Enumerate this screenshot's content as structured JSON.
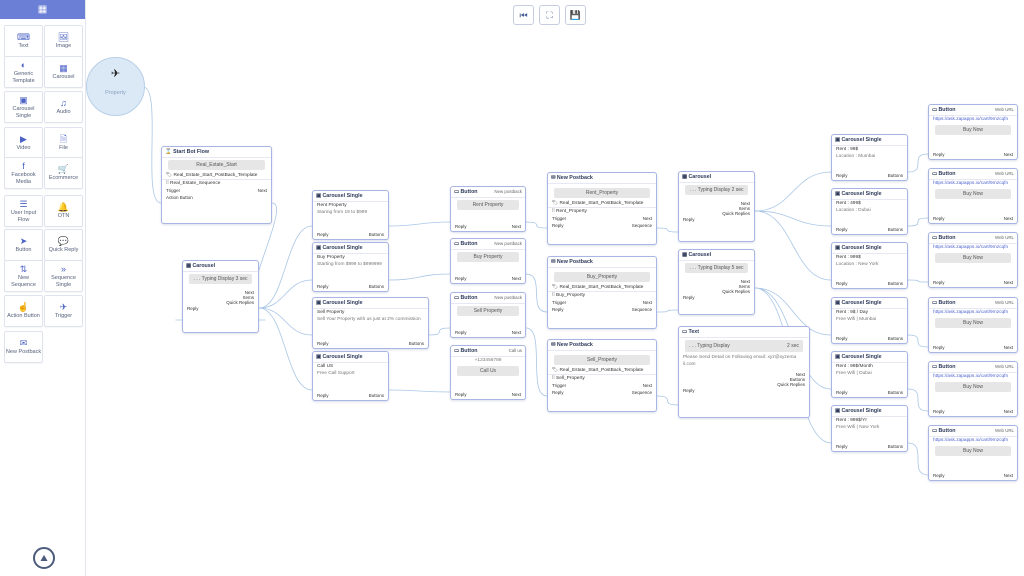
{
  "app": {
    "menu_icon": "grid-icon"
  },
  "toolbar": [
    {
      "name": "go-start-button",
      "icon": "⏮"
    },
    {
      "name": "fit-view-button",
      "icon": "⛶"
    },
    {
      "name": "save-button",
      "icon": "💾"
    }
  ],
  "sidebar": [
    {
      "label": "Text",
      "icon": "⌨"
    },
    {
      "label": "Image",
      "icon": "🖼"
    },
    {
      "label": "Generic Template",
      "icon": "◐"
    },
    {
      "label": "Carousel",
      "icon": "▦"
    },
    {
      "label": "Carousel Single",
      "icon": "▣"
    },
    {
      "label": "Audio",
      "icon": "♫"
    },
    {
      "label": "Video",
      "icon": "▶"
    },
    {
      "label": "File",
      "icon": "🗎"
    },
    {
      "label": "Facebook Media",
      "icon": "f"
    },
    {
      "label": "Ecommerce",
      "icon": "🛒"
    },
    {
      "label": "User Input Flow",
      "icon": "☰"
    },
    {
      "label": "OTN",
      "icon": "🔔"
    },
    {
      "label": "Button",
      "icon": "➤"
    },
    {
      "label": "Quick Reply",
      "icon": "💬"
    },
    {
      "label": "New Sequence",
      "icon": "⇅"
    },
    {
      "label": "Sequence Single",
      "icon": "»"
    },
    {
      "label": "Action Button",
      "icon": "☝"
    },
    {
      "label": "Trigger",
      "icon": "✈"
    },
    {
      "label": "New Postback",
      "icon": "✉"
    }
  ],
  "canvas": {
    "property": {
      "label": "Property",
      "icon": "✈"
    },
    "start_flow": {
      "title": "Start Bot Flow",
      "button": "Real_Estate_Start",
      "template": "Real_Estate_Start_PostBack_Template",
      "sequence": "Real_Estate_Sequence",
      "trigger": "Trigger",
      "action": "Action Button",
      "next": "Next"
    },
    "carousel_main": {
      "title": "Carousel",
      "typing": ". . . Typing Display 3 sec",
      "next": "Next",
      "items": "Items",
      "quick": "Quick Replies",
      "reply": "Reply"
    },
    "singles": [
      {
        "title": "Carousel Single",
        "l1": "Rent Property",
        "l2": "Staring from 19 to $999",
        "reply": "Reply",
        "buttons": "Buttons"
      },
      {
        "title": "Carousel Single",
        "l1": "Buy Property",
        "l2": "Starting from $999 to $999999",
        "reply": "Reply",
        "buttons": "Buttons"
      },
      {
        "title": "Carousel Single",
        "l1": "Sell Property",
        "l2": "Sell Your Property with us just at 2% commission",
        "reply": "Reply",
        "buttons": "Buttons"
      },
      {
        "title": "Carousel Single",
        "l1": "Call US",
        "l2": "Free Call Support",
        "reply": "Reply",
        "buttons": "Buttons"
      }
    ],
    "buttons_mid": [
      {
        "title": "Button",
        "sub": "New postback",
        "btn": "Rent Property",
        "extra": "",
        "reply": "Reply",
        "next": "Next"
      },
      {
        "title": "Button",
        "sub": "New postback",
        "btn": "Buy Property",
        "extra": "",
        "reply": "Reply",
        "next": "Next"
      },
      {
        "title": "Button",
        "sub": "New postback",
        "btn": "Sell Property",
        "extra": "",
        "reply": "Reply",
        "next": "Next"
      },
      {
        "title": "Button",
        "sub": "Call us",
        "btn": "Call Us",
        "extra": "+123456789",
        "reply": "Reply",
        "next": "Next"
      }
    ],
    "postbacks": [
      {
        "title": "New Postback",
        "btn": "Rent_Property",
        "template": "Real_Estate_Start_PostBack_Template",
        "sequence": "Rent_Property",
        "trigger": "Trigger",
        "next": "Next",
        "reply": "Reply",
        "seqlabel": "Sequence"
      },
      {
        "title": "New Postback",
        "btn": "Buy_Property",
        "template": "Real_Estate_Start_PostBack_Template",
        "sequence": "Buy_Property",
        "trigger": "Trigger",
        "next": "Next",
        "reply": "Reply",
        "seqlabel": "Sequence"
      },
      {
        "title": "New Postback",
        "btn": "Sell_Property",
        "template": "Real_Estate_Start_PostBack_Template",
        "sequence": "Sell_Property",
        "trigger": "Trigger",
        "next": "Next",
        "reply": "Reply",
        "seqlabel": "Sequence"
      }
    ],
    "carousels_right": [
      {
        "title": "Carousel",
        "typing": ". . . Typing Display 2 sec",
        "next": "Next",
        "items": "Items",
        "quick": "Quick Replies",
        "reply": "Reply"
      },
      {
        "title": "Carousel",
        "typing": ". . . Typing Display 5 sec",
        "next": "Next",
        "items": "Items",
        "quick": "Quick Replies",
        "reply": "Reply"
      }
    ],
    "text_node": {
      "title": "Text",
      "typing": ". . . Typing Display",
      "secs": "2 sec",
      "body1": "Please Send Detail on Following email: xyz@xyzema",
      "body2": "il.com",
      "next": "Next",
      "buttons": "Buttons",
      "quick": "Quick Replies",
      "reply": "Reply"
    },
    "singles_right": [
      {
        "title": "Carousel Single",
        "l1": "Rent : 99$",
        "l2": "Location : Mumbai",
        "reply": "Reply",
        "buttons": "Buttons"
      },
      {
        "title": "Carousel Single",
        "l1": "Rent : 499$",
        "l2": "Location : Dubai",
        "reply": "Reply",
        "buttons": "Buttons"
      },
      {
        "title": "Carousel Single",
        "l1": "Rent : 999$",
        "l2": "Location : New York",
        "reply": "Reply",
        "buttons": "Buttons"
      },
      {
        "title": "Carousel Single",
        "l1": "Rent : 9$ / Day",
        "l2": "Free Wifi | Mumbai",
        "reply": "Reply",
        "buttons": "Buttons"
      },
      {
        "title": "Carousel Single",
        "l1": "Rent : 99$/Month",
        "l2": "Free Wifi | Dubai",
        "reply": "Reply",
        "buttons": "Buttons"
      },
      {
        "title": "Carousel Single",
        "l1": "Rent : 999$/Yr",
        "l2": "Free Wifi | New York",
        "reply": "Reply",
        "buttons": "Buttons"
      }
    ],
    "buttons_far": [
      {
        "title": "Button",
        "sub": "Web URL",
        "url": "https://ask.zapapps.io/cart/9mzcqfn",
        "btn": "Buy Now",
        "reply": "Reply",
        "next": "Next"
      },
      {
        "title": "Button",
        "sub": "Web URL",
        "url": "https://ask.zapapps.io/cart/9mzcqfn",
        "btn": "Buy Now",
        "reply": "Reply",
        "next": "Next"
      },
      {
        "title": "Button",
        "sub": "Web URL",
        "url": "https://ask.zapapps.io/cart/9mzcqfn",
        "btn": "Buy Now",
        "reply": "Reply",
        "next": "Next"
      },
      {
        "title": "Button",
        "sub": "Web URL",
        "url": "https://ask.zapapps.io/cart/9mzcqfn",
        "btn": "Buy Now",
        "reply": "Reply",
        "next": "Next"
      },
      {
        "title": "Button",
        "sub": "Web URL",
        "url": "https://ask.zapapps.io/cart/9mzcqfn",
        "btn": "Buy Now",
        "reply": "Reply",
        "next": "Next"
      },
      {
        "title": "Button",
        "sub": "Web URL",
        "url": "https://ask.zapapps.io/cart/9mzcqfn",
        "btn": "Buy Now",
        "reply": "Reply",
        "next": "Next"
      }
    ]
  }
}
